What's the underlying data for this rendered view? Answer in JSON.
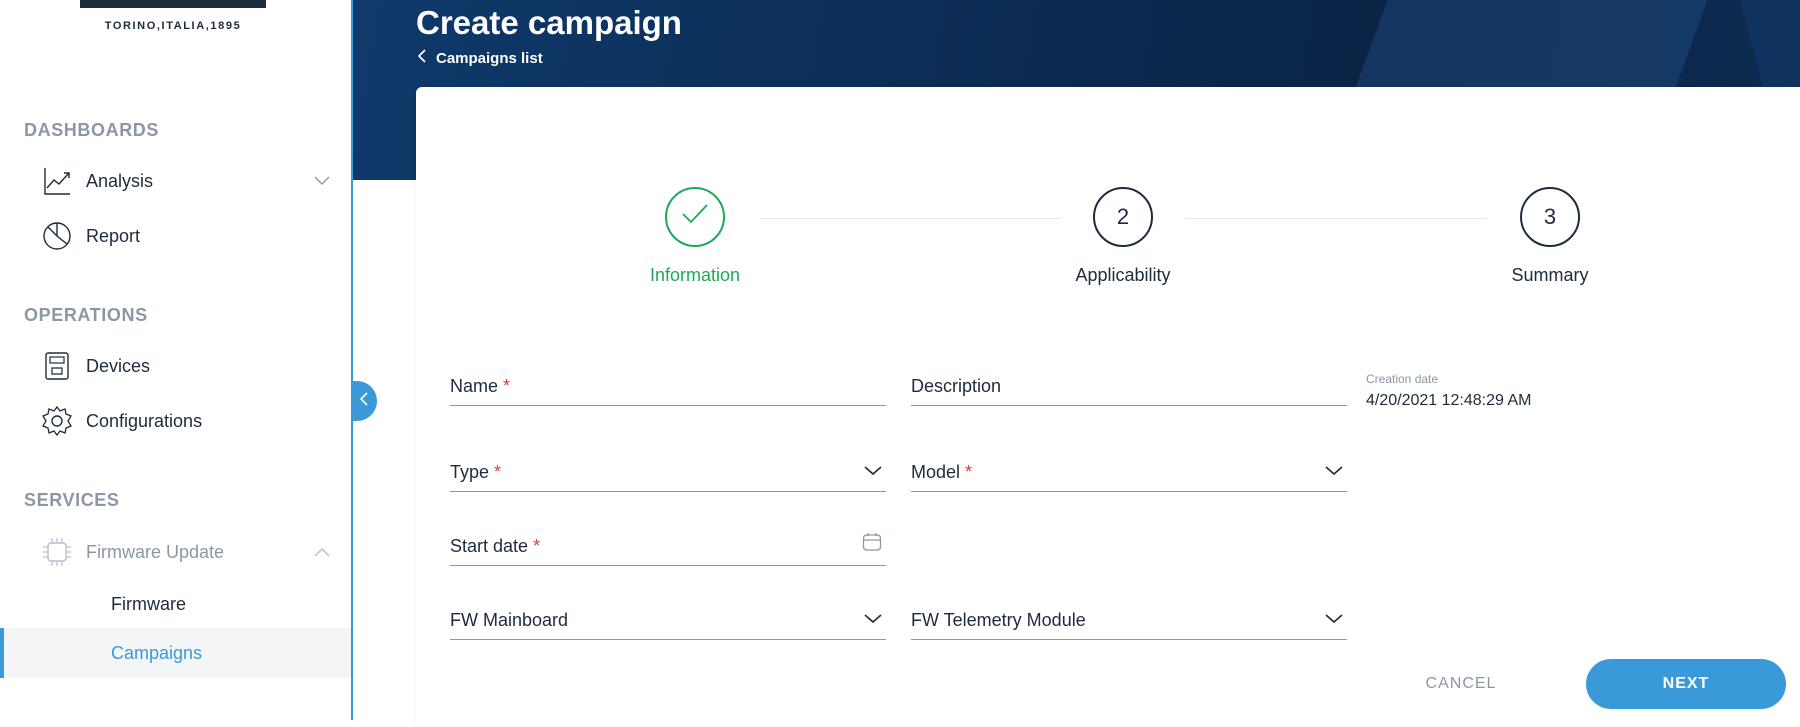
{
  "brand": {
    "tagline": "TORINO,ITALIA,1895"
  },
  "sidebar": {
    "sections": {
      "dashboards": "DASHBOARDS",
      "operations": "OPERATIONS",
      "services": "SERVICES"
    },
    "items": {
      "analysis": "Analysis",
      "report": "Report",
      "devices": "Devices",
      "configurations": "Configurations",
      "firmware_update": "Firmware Update",
      "firmware": "Firmware",
      "campaigns": "Campaigns"
    },
    "active_item": "Campaigns"
  },
  "header": {
    "title": "Create campaign",
    "breadcrumb": "Campaigns list"
  },
  "stepper": {
    "steps": [
      {
        "number": "",
        "label": "Information",
        "state": "completed"
      },
      {
        "number": "2",
        "label": "Applicability",
        "state": "pending"
      },
      {
        "number": "3",
        "label": "Summary",
        "state": "pending"
      }
    ]
  },
  "form": {
    "name_label": "Name",
    "description_label": "Description",
    "type_label": "Type",
    "model_label": "Model",
    "start_date_label": "Start date",
    "fw_mainboard_label": "FW Mainboard",
    "fw_telemetry_label": "FW Telemetry Module",
    "required_mark": "*",
    "creation_date_label": "Creation date",
    "creation_date_value": "4/20/2021 12:48:29 AM"
  },
  "actions": {
    "cancel": "CANCEL",
    "next": "NEXT"
  },
  "colors": {
    "accent": "#3a9ad9",
    "success": "#1fa85a",
    "navy": "#1d2b3e",
    "muted": "#8b97a6",
    "required": "#e53935"
  }
}
